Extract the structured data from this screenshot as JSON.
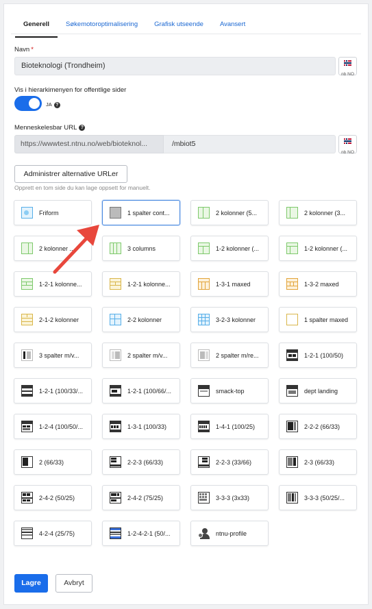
{
  "tabs": [
    {
      "label": "Generell",
      "active": true
    },
    {
      "label": "Søkemotoroptimalisering",
      "active": false
    },
    {
      "label": "Grafisk utseende",
      "active": false
    },
    {
      "label": "Avansert",
      "active": false
    }
  ],
  "name": {
    "label": "Navn",
    "required_mark": "*",
    "value": "Bioteknologi (Trondheim)",
    "lang_code": "nb NO"
  },
  "hierarchy": {
    "label": "Vis i hierarkimenyen for offentlige sider",
    "toggle_label": "JA",
    "enabled": true,
    "help_icon": "question-icon"
  },
  "url": {
    "label": "Menneskelesbar URL",
    "base": "https://wwwtest.ntnu.no/web/bioteknol...",
    "path": "/mbiot5",
    "lang_code": "nb NO"
  },
  "alt_urls_button": "Administrer alternative URLer",
  "helper_text": "Opprett en tom side du kan lage oppsett for manuelt.",
  "layouts": [
    "Friform",
    "1 spalter cont...",
    "2 kolonner (5...",
    "2 kolonner (3...",
    "2 kolonner ...",
    "3 columns",
    "1-2 kolonner (...",
    "1-2 kolonner (...",
    "1-2-1 kolonne...",
    "1-2-1 kolonne...",
    "1-3-1 maxed",
    "1-3-2 maxed",
    "2-1-2 kolonner",
    "2-2 kolonner",
    "3-2-3 kolonner",
    "1 spalter maxed",
    "3 spalter m/v...",
    "2 spalter m/v...",
    "2 spalter m/re...",
    "1-2-1 (100/50)",
    "1-2-1 (100/33/...",
    "1-2-1 (100/66/...",
    "smack-top",
    "dept landing",
    "1-2-4 (100/50/...",
    "1-3-1 (100/33)",
    "1-4-1 (100/25)",
    "2-2-2 (66/33)",
    "2 (66/33)",
    "2-2-3 (66/33)",
    "2-2-3 (33/66)",
    "2-3 (66/33)",
    "2-4-2 (50/25)",
    "2-4-2 (75/25)",
    "3-3-3 (3x33)",
    "3-3-3 (50/25/...",
    "4-2-4 (25/75)",
    "1-2-4-2-1 (50/...",
    "ntnu-profile"
  ],
  "selected_layout": 1,
  "actions": {
    "save": "Lagre",
    "cancel": "Avbryt"
  },
  "colors": {
    "accent": "#1a6dea",
    "link": "#1a67d2",
    "annotation_arrow": "#e8473c"
  }
}
